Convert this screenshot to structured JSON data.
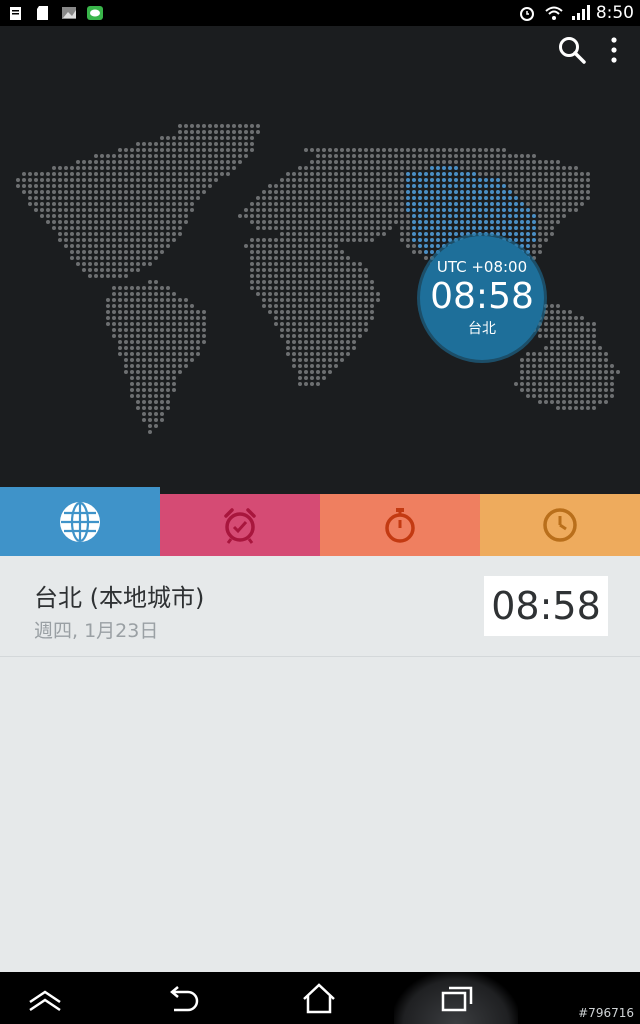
{
  "status_bar": {
    "time": "8:50",
    "icons": [
      "battery-note-icon",
      "sd-card-icon",
      "photo-icon",
      "line-app-icon",
      "alarm-icon",
      "wifi-icon",
      "signal-icon"
    ]
  },
  "actions": {
    "search_icon": "search-icon",
    "menu_icon": "overflow-menu-icon"
  },
  "bubble": {
    "utc": "UTC +08:00",
    "time": "08:58",
    "city": "台北"
  },
  "tabs": [
    {
      "name": "world-clock",
      "icon": "globe-icon",
      "color": "#3f93c9",
      "selected": true
    },
    {
      "name": "alarm",
      "icon": "alarm-clock-icon",
      "color": "#d54b74"
    },
    {
      "name": "stopwatch",
      "icon": "stopwatch-icon",
      "color": "#ef7f60"
    },
    {
      "name": "timer",
      "icon": "timer-icon",
      "color": "#eeab5d"
    }
  ],
  "city": {
    "name": "台北 (本地城市)",
    "date": "週四, 1月23日",
    "time": "08:58"
  },
  "nav": {
    "icons": [
      "collapse-icon",
      "back-icon",
      "home-icon",
      "recent-apps-icon"
    ]
  },
  "watermark": "#796716",
  "colors": {
    "map_dots": "#6d6f71",
    "map_highlight": "#4a8ec4",
    "bubble": "#1e6f9a"
  }
}
